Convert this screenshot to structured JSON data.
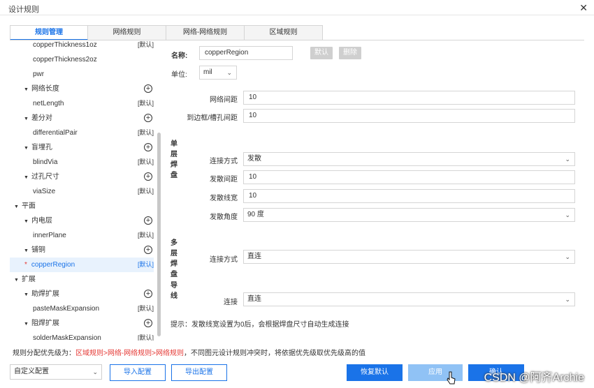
{
  "window": {
    "title": "设计规则"
  },
  "tabs": [
    "规则管理",
    "网络规则",
    "网络-网络规则",
    "区域规则"
  ],
  "tree": [
    {
      "label": "copperThickness1oz",
      "indent": 2,
      "tag": "[默认]",
      "type": "leaf"
    },
    {
      "label": "copperThickness2oz",
      "indent": 2,
      "tag": "",
      "type": "leaf"
    },
    {
      "label": "pwr",
      "indent": 2,
      "tag": "",
      "type": "leaf"
    },
    {
      "label": "网络长度",
      "indent": 1,
      "type": "group"
    },
    {
      "label": "netLength",
      "indent": 2,
      "tag": "[默认]",
      "type": "leaf"
    },
    {
      "label": "差分对",
      "indent": 1,
      "type": "group"
    },
    {
      "label": "differentialPair",
      "indent": 2,
      "tag": "[默认]",
      "type": "leaf"
    },
    {
      "label": "盲埋孔",
      "indent": 1,
      "type": "group"
    },
    {
      "label": "blindVia",
      "indent": 2,
      "tag": "[默认]",
      "type": "leaf"
    },
    {
      "label": "过孔尺寸",
      "indent": 1,
      "type": "group"
    },
    {
      "label": "viaSize",
      "indent": 2,
      "tag": "[默认]",
      "type": "leaf"
    },
    {
      "label": "平面",
      "indent": 0,
      "type": "root"
    },
    {
      "label": "内电层",
      "indent": 1,
      "type": "group"
    },
    {
      "label": "innerPlane",
      "indent": 2,
      "tag": "[默认]",
      "type": "leaf"
    },
    {
      "label": "铺铜",
      "indent": 1,
      "type": "group"
    },
    {
      "label": "copperRegion",
      "indent": 2,
      "tag": "[默认]",
      "type": "leaf",
      "selected": true
    },
    {
      "label": "扩展",
      "indent": 0,
      "type": "root"
    },
    {
      "label": "助焊扩展",
      "indent": 1,
      "type": "group"
    },
    {
      "label": "pasteMaskExpansion",
      "indent": 2,
      "tag": "[默认]",
      "type": "leaf"
    },
    {
      "label": "阻焊扩展",
      "indent": 1,
      "type": "group"
    },
    {
      "label": "solderMaskExpansion",
      "indent": 2,
      "tag": "[默认]",
      "type": "leaf"
    }
  ],
  "form": {
    "name_label": "名称:",
    "name_value": "copperRegion",
    "default_btn": "默认",
    "delete_btn": "删除",
    "unit_label": "单位:",
    "unit_value": "mil",
    "net_spacing_label": "网络间距",
    "net_spacing_value": "10",
    "edge_spacing_label": "到边框/槽孔间距",
    "edge_spacing_value": "10",
    "single_pad_title": "单层焊盘",
    "connect_mode_label": "连接方式",
    "connect_mode_value": "发散",
    "spoke_spacing_label": "发散间距",
    "spoke_spacing_value": "10",
    "spoke_width_label": "发散线宽",
    "spoke_width_value": "10",
    "spoke_angle_label": "发散角度",
    "spoke_angle_value": "90 度",
    "multi_pad_title": "多层焊盘",
    "multi_connect_label": "连接方式",
    "multi_connect_value": "直连",
    "wire_title": "导线",
    "wire_connect_label": "连接",
    "wire_connect_value": "直连",
    "hint": "提示：发散线宽设置为0后，会根据焊盘尺寸自动生成连接"
  },
  "priority": {
    "prefix": "规则分配优先级为：",
    "order": "区域规则>网络-网络规则>网络规则",
    "suffix": "，不同图元设计规则冲突时，将依据优先级取优先级高的值"
  },
  "footer": {
    "config_value": "自定义配置",
    "import_btn": "导入配置",
    "export_btn": "导出配置",
    "reset_btn": "恢复默认",
    "apply_btn": "应用",
    "ok_btn": "确认"
  },
  "watermark": "CSDN @阿齐Archie",
  "colors": {
    "accent": "#1a73e8",
    "selected_bg": "#e8f2fd",
    "warning": "#e53935"
  }
}
